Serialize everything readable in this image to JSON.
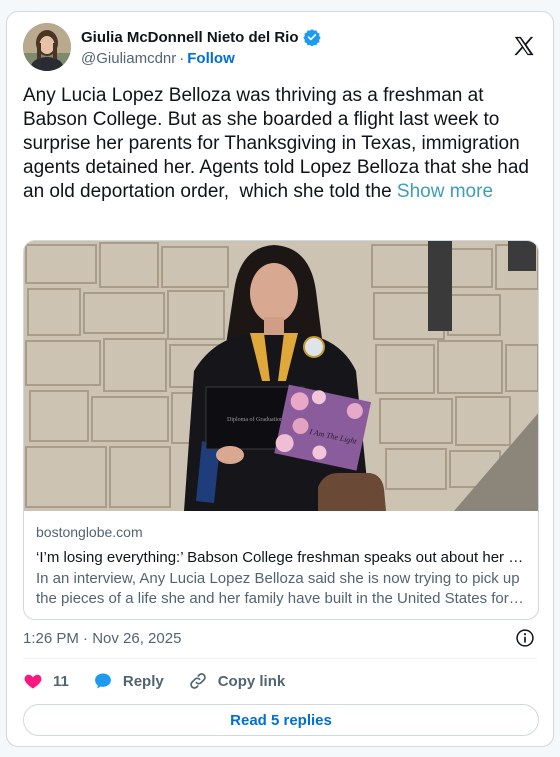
{
  "author": {
    "display_name": "Giulia McDonnell Nieto del Rio",
    "handle": "@Giuliamcdnr",
    "separator": "·",
    "follow_label": "Follow"
  },
  "tweet": {
    "text": "Any Lucia Lopez Belloza was thriving as a freshman at Babson College. But as she boarded a flight last week to surprise her parents for Thanksgiving in Texas, immigration agents detained her. Agents told Lopez Belloza that she had an old deportation order,  which she told the ",
    "show_more_label": "Show more"
  },
  "link_card": {
    "domain": "bostonglobe.com",
    "title": "‘I’m losing everything:’ Babson College freshman speaks out about her …",
    "description": "In an interview, Any Lucia Lopez Belloza said she is now trying to pick up the pieces of a life she and her family have built in the United States for…",
    "diploma_text": "Diploma of Graduation",
    "cap_text": "I Am The Light"
  },
  "meta": {
    "timestamp": "1:26 PM · Nov 26, 2025"
  },
  "actions": {
    "likes_count": "11",
    "reply_label": "Reply",
    "copy_link_label": "Copy link",
    "read_replies_label": "Read 5 replies"
  },
  "colors": {
    "like": "#f91880",
    "reply": "#1d9bf0",
    "link": "#006fd6",
    "verified": "#1d9bf0"
  }
}
